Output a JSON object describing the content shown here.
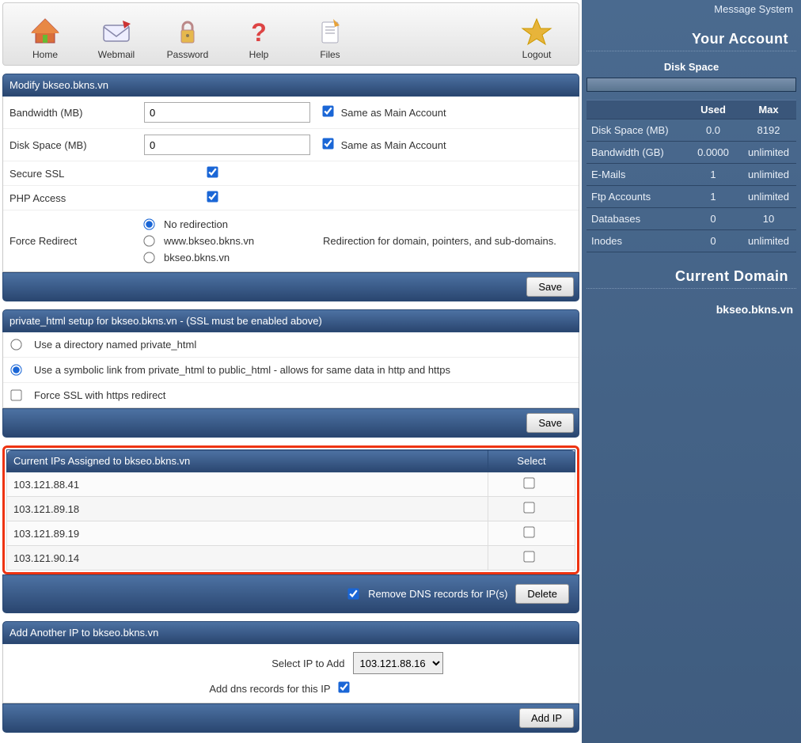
{
  "toolbar": {
    "home": "Home",
    "webmail": "Webmail",
    "password": "Password",
    "help": "Help",
    "files": "Files",
    "logout": "Logout"
  },
  "modify": {
    "title": "Modify bkseo.bkns.vn",
    "bandwidth_label": "Bandwidth (MB)",
    "bandwidth_value": "0",
    "bandwidth_same": "Same as Main Account",
    "disk_label": "Disk Space (MB)",
    "disk_value": "0",
    "disk_same": "Same as Main Account",
    "ssl_label": "Secure SSL",
    "php_label": "PHP Access",
    "redirect_label": "Force Redirect",
    "redirect_none": "No redirection",
    "redirect_www": "www.bkseo.bkns.vn",
    "redirect_bare": "bkseo.bkns.vn",
    "redirect_hint": "Redirection for domain, pointers, and sub-domains.",
    "save": "Save"
  },
  "private_html": {
    "title": "private_html setup for bkseo.bkns.vn - (SSL must be enabled above)",
    "opt_dir": "Use a directory named private_html",
    "opt_symlink": "Use a symbolic link from private_html to public_html - allows for same data in http and https",
    "opt_force": "Force SSL with https redirect",
    "save": "Save"
  },
  "ips": {
    "title": "Current IPs Assigned to bkseo.bkns.vn",
    "select": "Select",
    "rows": [
      {
        "ip": "103.121.88.41"
      },
      {
        "ip": "103.121.89.18"
      },
      {
        "ip": "103.121.89.19"
      },
      {
        "ip": "103.121.90.14"
      }
    ],
    "remove_dns": "Remove DNS records for IP(s)",
    "delete": "Delete"
  },
  "addip": {
    "title": "Add Another IP to bkseo.bkns.vn",
    "select_label": "Select IP to Add",
    "selected": "103.121.88.16",
    "add_dns": "Add dns records for this IP",
    "add": "Add IP"
  },
  "side": {
    "msg": "Message System",
    "account_h": "Your Account",
    "disk_space_h": "Disk Space",
    "used": "Used",
    "max": "Max",
    "rows": [
      {
        "k": "Disk Space (MB)",
        "u": "0.0",
        "m": "8192"
      },
      {
        "k": "Bandwidth (GB)",
        "u": "0.0000",
        "m": "unlimited"
      },
      {
        "k": "E-Mails",
        "u": "1",
        "m": "unlimited"
      },
      {
        "k": "Ftp Accounts",
        "u": "1",
        "m": "unlimited"
      },
      {
        "k": "Databases",
        "u": "0",
        "m": "10"
      },
      {
        "k": "Inodes",
        "u": "0",
        "m": "unlimited"
      }
    ],
    "domain_h": "Current Domain",
    "domain": "bkseo.bkns.vn"
  }
}
